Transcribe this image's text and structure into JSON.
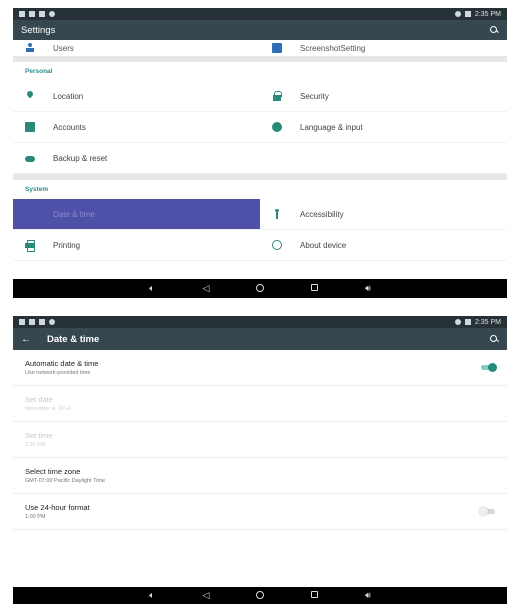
{
  "screen1": {
    "status_time": "2:35 PM",
    "title": "Settings",
    "top_row": {
      "left": "Users",
      "right": "ScreenshotSetting"
    },
    "personal": {
      "header": "Personal",
      "items": [
        {
          "label": "Location",
          "icon": "location-icon"
        },
        {
          "label": "Security",
          "icon": "lock-icon"
        },
        {
          "label": "Accounts",
          "icon": "accounts-icon"
        },
        {
          "label": "Language & input",
          "icon": "globe-icon"
        },
        {
          "label": "Backup & reset",
          "icon": "cloud-icon"
        }
      ]
    },
    "system": {
      "header": "System",
      "items": [
        {
          "label": "Date & time",
          "icon": "clock-icon",
          "highlighted": true
        },
        {
          "label": "Accessibility",
          "icon": "accessibility-icon"
        },
        {
          "label": "Printing",
          "icon": "printer-icon"
        },
        {
          "label": "About device",
          "icon": "info-icon"
        }
      ]
    }
  },
  "screen2": {
    "status_time": "2:35 PM",
    "title": "Date & time",
    "items": [
      {
        "title": "Automatic date & time",
        "subtitle": "Use network-provided time",
        "toggle": "on"
      },
      {
        "title": "Set date",
        "subtitle": "November 4, 2014",
        "disabled": true
      },
      {
        "title": "Set time",
        "subtitle": "2:35 PM",
        "disabled": true
      },
      {
        "title": "Select time zone",
        "subtitle": "GMT-07:00 Pacific Daylight Time"
      },
      {
        "title": "Use 24-hour format",
        "subtitle": "1:00 PM",
        "toggle": "off"
      }
    ]
  },
  "colors": {
    "status_bar": "#263238",
    "app_bar": "#37474f",
    "accent": "#26897b",
    "highlight": "#4f50a8"
  },
  "nav_icons": [
    "volume-down-icon",
    "back-icon",
    "home-icon",
    "recents-icon",
    "volume-up-icon"
  ]
}
